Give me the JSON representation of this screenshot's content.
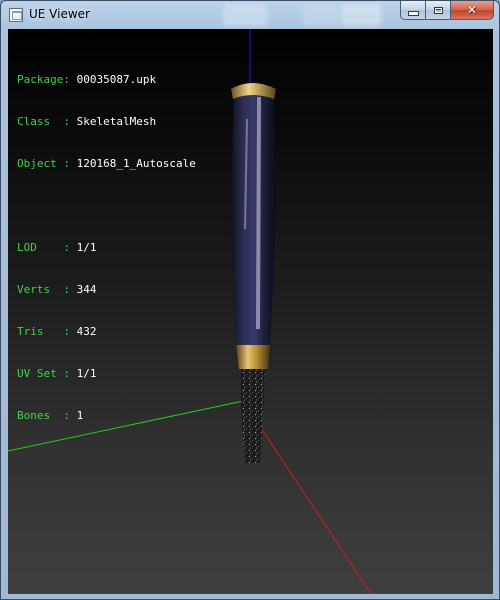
{
  "window": {
    "title": "UE Viewer",
    "icon": "app-window-icon",
    "controls": [
      "minimize-icon",
      "maximize-icon",
      "close-icon"
    ],
    "close_glyph": "✕"
  },
  "info": {
    "package_label": "Package:",
    "package_value": "00035087.upk",
    "class_label": "Class  :",
    "class_value": "SkeletalMesh",
    "object_label": "Object :",
    "object_value": "120168_1_Autoscale",
    "lod_label": "LOD    :",
    "lod_value": "1/1",
    "verts_label": "Verts  :",
    "verts_value": "344",
    "tris_label": "Tris   :",
    "tris_value": "432",
    "uvset_label": "UV Set :",
    "uvset_value": "1/1",
    "bones_label": "Bones  :",
    "bones_value": "1"
  },
  "colors": {
    "label_text": "#3fd34a",
    "value_text": "#ffffff",
    "axis_x": "#d81b1b",
    "axis_y": "#22cc22",
    "axis_z": "#1a1aff",
    "mesh_body": "#23233f",
    "mesh_band": "#b8913a"
  }
}
